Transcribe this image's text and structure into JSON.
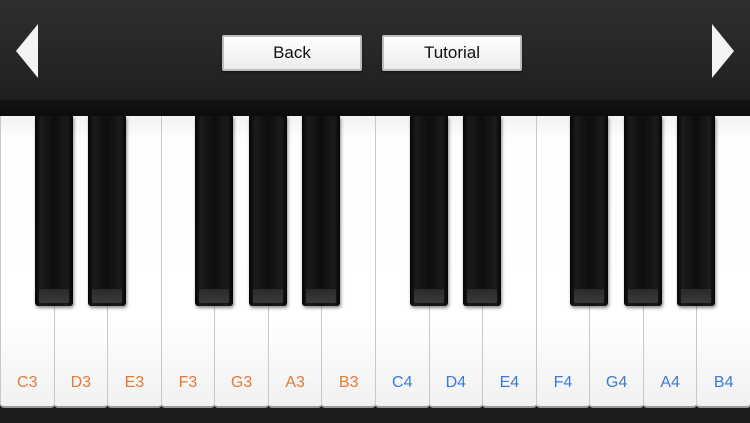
{
  "toolbar": {
    "back_label": "Back",
    "tutorial_label": "Tutorial",
    "prev_icon": "chevron-left-icon",
    "next_icon": "chevron-right-icon"
  },
  "colors": {
    "octave3_label": "#e07b39",
    "octave4_label": "#3a7bd5"
  },
  "keyboard": {
    "white_keys": [
      {
        "label": "C3",
        "octave": 3
      },
      {
        "label": "D3",
        "octave": 3
      },
      {
        "label": "E3",
        "octave": 3
      },
      {
        "label": "F3",
        "octave": 3
      },
      {
        "label": "G3",
        "octave": 3
      },
      {
        "label": "A3",
        "octave": 3
      },
      {
        "label": "B3",
        "octave": 3
      },
      {
        "label": "C4",
        "octave": 4
      },
      {
        "label": "D4",
        "octave": 4
      },
      {
        "label": "E4",
        "octave": 4
      },
      {
        "label": "F4",
        "octave": 4
      },
      {
        "label": "G4",
        "octave": 4
      },
      {
        "label": "A4",
        "octave": 4
      },
      {
        "label": "B4",
        "octave": 4
      }
    ],
    "black_keys_after_white_index": [
      0,
      1,
      3,
      4,
      5,
      7,
      8,
      10,
      11,
      12
    ]
  }
}
